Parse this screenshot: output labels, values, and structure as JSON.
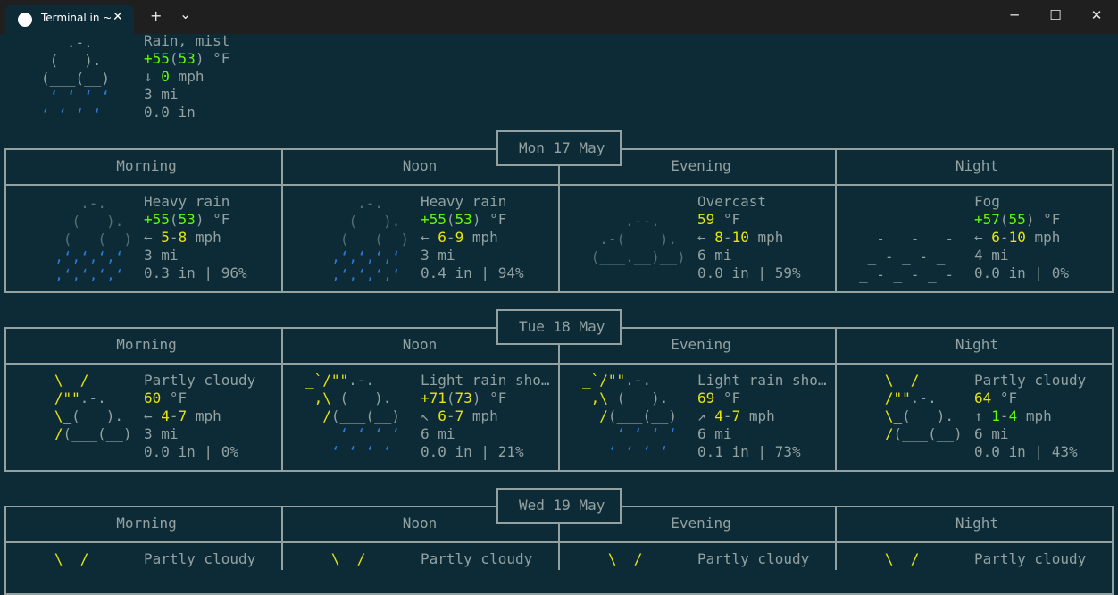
{
  "window": {
    "tab_title": "Terminal in ~",
    "new_tab_glyph": "+",
    "dropdown_glyph": "⌄",
    "tab_close_glyph": "✕",
    "minimize_glyph": "─",
    "maximize_glyph": "☐",
    "close_glyph": "✕"
  },
  "colors": {
    "background": "#0c2b36",
    "text": "#93a1a1",
    "rain": "#2a7bde",
    "sun": "#e5e510",
    "temp_green": "#5fff00",
    "temp_yellow": "#e5e510",
    "cloud_dim": "#586e75"
  },
  "current": {
    "description": "Rain, mist",
    "temp": "+55",
    "feels": "53",
    "temp_unit": " °F",
    "wind_dir": "↓",
    "wind": "0",
    "wind_unit": " mph",
    "visibility": "3 mi",
    "precip": "0.0 in"
  },
  "days": [
    {
      "date": "Mon 17 May",
      "periods": [
        {
          "name": "Morning",
          "description": "Heavy rain",
          "temp": "+55",
          "feels": "53",
          "wind_dir": "←",
          "wind_lo": "5",
          "wind_hi": "8",
          "visibility": "3 mi",
          "precip": "0.3 in | 96%"
        },
        {
          "name": "Noon",
          "description": "Heavy rain",
          "temp": "+55",
          "feels": "53",
          "wind_dir": "←",
          "wind_lo": "6",
          "wind_hi": "9",
          "visibility": "3 mi",
          "precip": "0.4 in | 94%"
        },
        {
          "name": "Evening",
          "description": "Overcast",
          "temp": "59",
          "feels": "",
          "wind_dir": "←",
          "wind_lo": "8",
          "wind_hi": "10",
          "visibility": "6 mi",
          "precip": "0.0 in | 59%"
        },
        {
          "name": "Night",
          "description": "Fog",
          "temp": "+57",
          "feels": "55",
          "wind_dir": "←",
          "wind_lo": "6",
          "wind_hi": "10",
          "visibility": "4 mi",
          "precip": "0.0 in | 0%"
        }
      ]
    },
    {
      "date": "Tue 18 May",
      "periods": [
        {
          "name": "Morning",
          "description": "Partly cloudy",
          "temp": "60",
          "feels": "",
          "wind_dir": "←",
          "wind_lo": "4",
          "wind_hi": "7",
          "visibility": "3 mi",
          "precip": "0.0 in | 0%"
        },
        {
          "name": "Noon",
          "description": "Light rain sho…",
          "temp": "+71",
          "feels": "73",
          "wind_dir": "↖",
          "wind_lo": "6",
          "wind_hi": "7",
          "visibility": "6 mi",
          "precip": "0.0 in | 21%"
        },
        {
          "name": "Evening",
          "description": "Light rain sho…",
          "temp": "69",
          "feels": "",
          "wind_dir": "↗",
          "wind_lo": "4",
          "wind_hi": "7",
          "visibility": "6 mi",
          "precip": "0.1 in | 73%"
        },
        {
          "name": "Night",
          "description": "Partly cloudy",
          "temp": "64",
          "feels": "",
          "wind_dir": "↑",
          "wind_lo": "1",
          "wind_hi": "4",
          "visibility": "6 mi",
          "precip": "0.0 in | 43%"
        }
      ]
    },
    {
      "date": "Wed 19 May",
      "periods": [
        {
          "name": "Morning",
          "description": "Partly cloudy"
        },
        {
          "name": "Noon",
          "description": "Partly cloudy"
        },
        {
          "name": "Evening",
          "description": "Partly cloudy"
        },
        {
          "name": "Night",
          "description": "Partly cloudy"
        }
      ]
    }
  ]
}
